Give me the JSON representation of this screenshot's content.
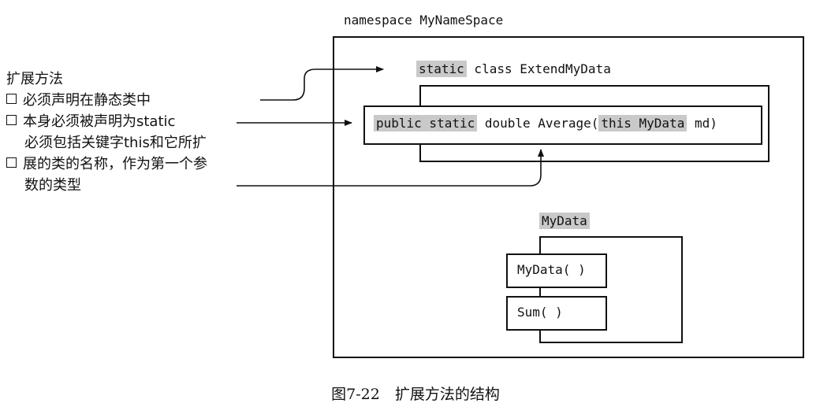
{
  "namespace_label": "namespace MyNameSpace",
  "static_class": {
    "keyword": "static",
    "rest": " class ExtendMyData"
  },
  "method": {
    "kw_public_static": "public static",
    "mid": " double Average(",
    "kw_this_mydata": "this MyData",
    "tail": " md)"
  },
  "mydata": {
    "title": "MyData",
    "ctor": "MyData( )",
    "sum": "Sum( )"
  },
  "notes": {
    "heading": "扩展方法",
    "item1": "必须声明在静态类中",
    "item2": "本身必须被声明为static",
    "item3_line1": "必须包括关键字this和它所扩",
    "item3_line2": "展的类的名称，作为第一个参",
    "item3_line3": "数的类型"
  },
  "caption": "图7-22　扩展方法的结构"
}
